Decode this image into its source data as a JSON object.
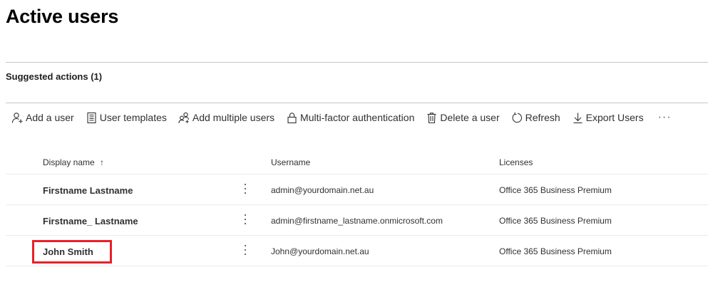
{
  "page": {
    "title": "Active users",
    "suggested_actions": "Suggested actions (1)"
  },
  "toolbar": {
    "items": [
      {
        "label": "Add a user",
        "icon": "person-add-icon"
      },
      {
        "label": "User templates",
        "icon": "template-icon"
      },
      {
        "label": "Add multiple users",
        "icon": "people-add-icon"
      },
      {
        "label": "Multi-factor authentication",
        "icon": "lock-icon"
      },
      {
        "label": "Delete a user",
        "icon": "trash-icon"
      },
      {
        "label": "Refresh",
        "icon": "refresh-icon"
      },
      {
        "label": "Export Users",
        "icon": "download-icon"
      }
    ],
    "more": "···"
  },
  "table": {
    "columns": {
      "display_name": "Display name",
      "sort_indicator": "↑",
      "username": "Username",
      "licenses": "Licenses"
    },
    "rows": [
      {
        "display_name": "Firstname Lastname",
        "username": "admin@yourdomain.net.au",
        "licenses": "Office 365 Business Premium"
      },
      {
        "display_name": "Firstname_ Lastname",
        "username": "admin@firstname_lastname.onmicrosoft.com",
        "licenses": "Office 365 Business Premium"
      },
      {
        "display_name": "John Smith",
        "username": "John@yourdomain.net.au",
        "licenses": "Office 365 Business Premium"
      }
    ]
  },
  "colors": {
    "highlight": "#e8202a",
    "divider": "#c8c6c4",
    "text": "#323130"
  }
}
